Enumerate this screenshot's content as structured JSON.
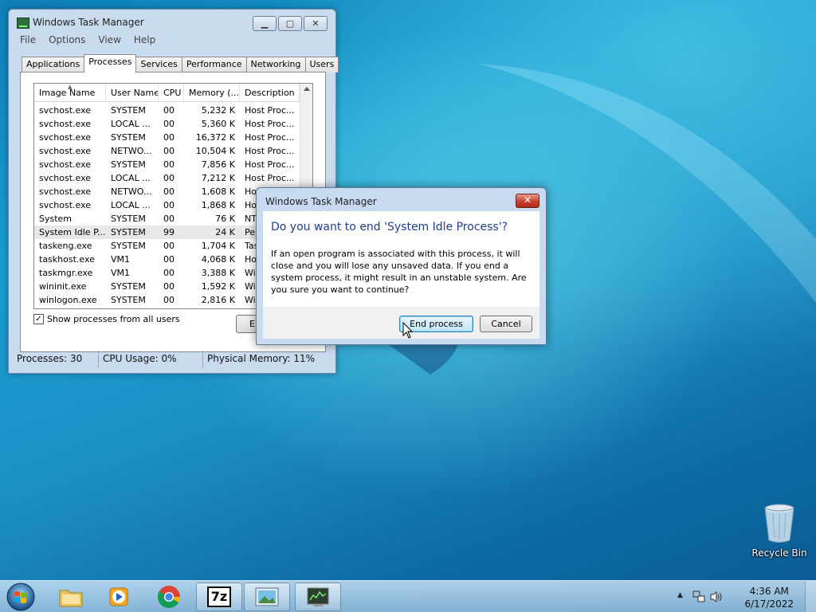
{
  "task_manager": {
    "title": "Windows Task Manager",
    "menu": [
      "File",
      "Options",
      "View",
      "Help"
    ],
    "tabs": [
      "Applications",
      "Processes",
      "Services",
      "Performance",
      "Networking",
      "Users"
    ],
    "active_tab": "Processes",
    "columns": [
      "Image Name",
      "User Name",
      "CPU",
      "Memory (...",
      "Description"
    ],
    "processes": [
      {
        "image": "svchost.exe",
        "user": "SYSTEM",
        "cpu": "00",
        "mem": "5,232 K",
        "desc": "Host Proc..."
      },
      {
        "image": "svchost.exe",
        "user": "LOCAL ...",
        "cpu": "00",
        "mem": "5,360 K",
        "desc": "Host Proc..."
      },
      {
        "image": "svchost.exe",
        "user": "SYSTEM",
        "cpu": "00",
        "mem": "16,372 K",
        "desc": "Host Proc..."
      },
      {
        "image": "svchost.exe",
        "user": "NETWO...",
        "cpu": "00",
        "mem": "10,504 K",
        "desc": "Host Proc..."
      },
      {
        "image": "svchost.exe",
        "user": "SYSTEM",
        "cpu": "00",
        "mem": "7,856 K",
        "desc": "Host Proc..."
      },
      {
        "image": "svchost.exe",
        "user": "LOCAL ...",
        "cpu": "00",
        "mem": "7,212 K",
        "desc": "Host Proc..."
      },
      {
        "image": "svchost.exe",
        "user": "NETWO...",
        "cpu": "00",
        "mem": "1,608 K",
        "desc": "Hos"
      },
      {
        "image": "svchost.exe",
        "user": "LOCAL ...",
        "cpu": "00",
        "mem": "1,868 K",
        "desc": "Hos"
      },
      {
        "image": "System",
        "user": "SYSTEM",
        "cpu": "00",
        "mem": "76 K",
        "desc": "NT"
      },
      {
        "image": "System Idle P...",
        "user": "SYSTEM",
        "cpu": "99",
        "mem": "24 K",
        "desc": "Per"
      },
      {
        "image": "taskeng.exe",
        "user": "SYSTEM",
        "cpu": "00",
        "mem": "1,704 K",
        "desc": "Tas"
      },
      {
        "image": "taskhost.exe",
        "user": "VM1",
        "cpu": "00",
        "mem": "4,068 K",
        "desc": "Hos"
      },
      {
        "image": "taskmgr.exe",
        "user": "VM1",
        "cpu": "00",
        "mem": "3,388 K",
        "desc": "Win"
      },
      {
        "image": "wininit.exe",
        "user": "SYSTEM",
        "cpu": "00",
        "mem": "1,592 K",
        "desc": "Win"
      },
      {
        "image": "winlogon.exe",
        "user": "SYSTEM",
        "cpu": "00",
        "mem": "2,816 K",
        "desc": "Win"
      }
    ],
    "selected_index": 9,
    "show_all_label": "Show processes from all users",
    "show_all_checked": true,
    "end_button_partial": "E",
    "status": {
      "processes": "Processes: 30",
      "cpu": "CPU Usage: 0%",
      "memory": "Physical Memory: 11%"
    }
  },
  "dialog": {
    "title": "Windows Task Manager",
    "close_label": "✕",
    "instruction": "Do you want to end 'System Idle Process'?",
    "message": "If an open program is associated with this process, it will close and you will lose any unsaved data. If you end a system process, it might result in an unstable system. Are you sure you want to continue?",
    "end_button": "End process",
    "cancel_button": "Cancel"
  },
  "desktop": {
    "recycle_bin_label": "Recycle Bin"
  },
  "taskbar": {
    "pinned": [
      "windows-explorer",
      "media-player",
      "chrome",
      "7zip",
      "picture-viewer",
      "task-manager"
    ],
    "seven_zip_label": "7z",
    "time": "4:36 AM",
    "date": "6/17/2022"
  }
}
